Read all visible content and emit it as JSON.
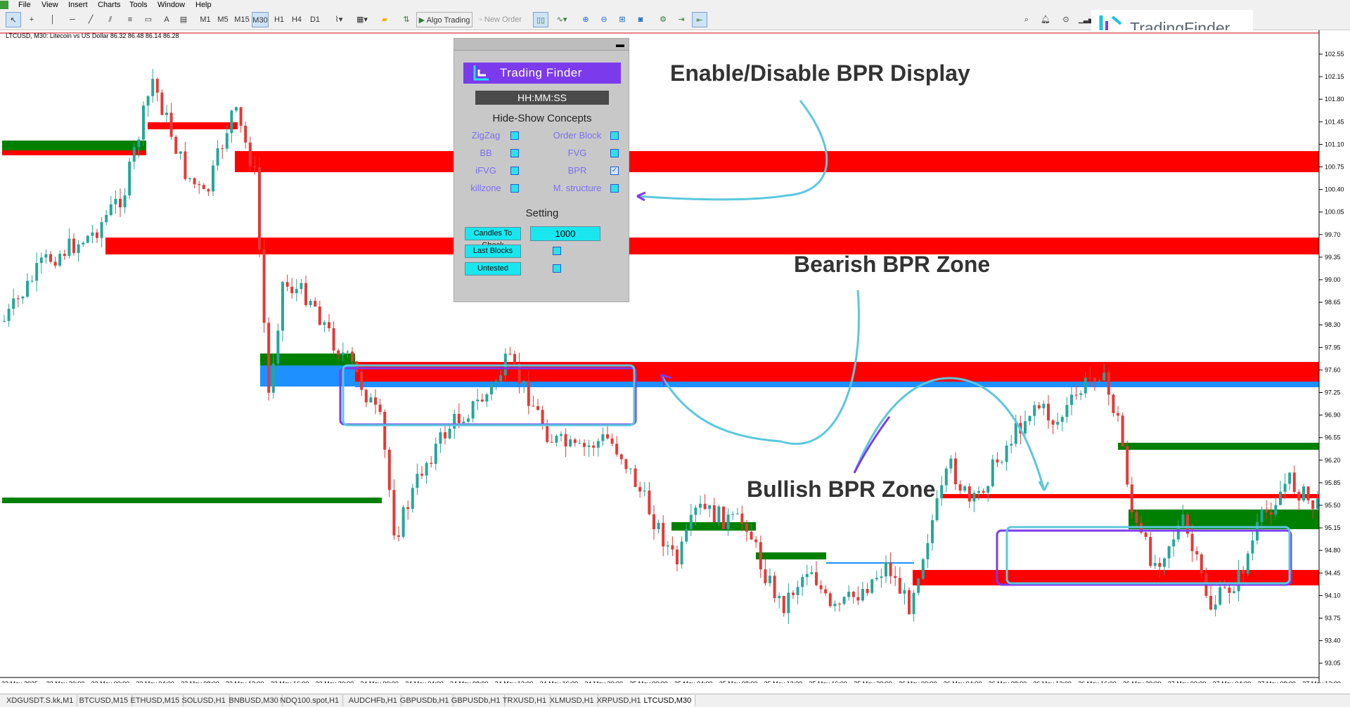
{
  "menu": [
    "File",
    "View",
    "Insert",
    "Charts",
    "Tools",
    "Window",
    "Help"
  ],
  "toolbar": {
    "timeframes": [
      "M1",
      "M5",
      "M15",
      "M30",
      "H1",
      "H4",
      "D1"
    ],
    "active_timeframe": "M30",
    "algo_trading": "Algo Trading",
    "new_order": "New Order"
  },
  "brand": {
    "name": "TradingFinder"
  },
  "chart": {
    "symbol_info": "LTCUSD, M30:  Litecoin vs US Dollar  86.32 86.48 86.14 86.28",
    "price_labels": [
      "102.55",
      "102.15",
      "101.80",
      "101.45",
      "101.10",
      "100.75",
      "100.40",
      "100.05",
      "99.70",
      "99.35",
      "99.00",
      "98.65",
      "98.30",
      "97.95",
      "97.60",
      "97.25",
      "96.90",
      "96.55",
      "96.20",
      "95.85",
      "95.50",
      "95.15",
      "94.80",
      "94.45",
      "94.10",
      "93.75",
      "93.40",
      "93.05"
    ],
    "time_labels": [
      "22 May 2025",
      "22 May 20:00",
      "23 May 00:00",
      "23 May 04:00",
      "23 May 08:00",
      "23 May 12:00",
      "23 May 16:00",
      "23 May 20:00",
      "24 May 00:00",
      "24 May 04:00",
      "24 May 08:00",
      "24 May 12:00",
      "24 May 16:00",
      "24 May 20:00",
      "25 May 00:00",
      "25 May 04:00",
      "25 May 08:00",
      "25 May 12:00",
      "25 May 16:00",
      "25 May 20:00",
      "26 May 00:00",
      "26 May 04:00",
      "26 May 08:00",
      "26 May 12:00",
      "26 May 16:00",
      "26 May 20:00",
      "27 May 00:00",
      "27 May 04:00",
      "27 May 08:00",
      "27 May 12:00"
    ],
    "colors": {
      "bull": "#26a69a",
      "bear": "#e53935",
      "bearish_zone": "#ff0000",
      "bullish_zone": "#008000",
      "blue_zone": "#1e90ff"
    }
  },
  "panel": {
    "brand": "Trading Finder",
    "clock": "HH:MM:SS",
    "concepts_heading": "Hide-Show Concepts",
    "concepts": [
      {
        "label": "ZigZag",
        "checked": false
      },
      {
        "label": "Order Block",
        "checked": false
      },
      {
        "label": "BB",
        "checked": false
      },
      {
        "label": "FVG",
        "checked": false
      },
      {
        "label": "iFVG",
        "checked": false
      },
      {
        "label": "BPR",
        "checked": true
      },
      {
        "label": "killzone",
        "checked": false
      },
      {
        "label": "M. structure",
        "checked": false
      }
    ],
    "setting_heading": "Setting",
    "candles_to_check_label": "Candles To Check",
    "candles_to_check_value": "1000",
    "last_blocks_label": "Last Blocks",
    "untested_label": "Untested"
  },
  "annotations": {
    "enable_disable": "Enable/Disable BPR Display",
    "bearish": "Bearish BPR Zone",
    "bullish": "Bullish BPR Zone"
  },
  "tabs": [
    "XDGUSDT.S.kk,M1",
    "BTCUSD,M15",
    "ETHUSD,M15",
    "SOLUSD,H1",
    "BNBUSD,M30",
    "NDQ100.spot,H1",
    "AUDCHFb,H1",
    "GBPUSDb,H1",
    "GBPUSDb,H1",
    "TRXUSD,H1",
    "XLMUSD,H1",
    "XRPUSD,H1",
    "LTCUSD,M30"
  ],
  "active_tab": "LTCUSD,M30"
}
